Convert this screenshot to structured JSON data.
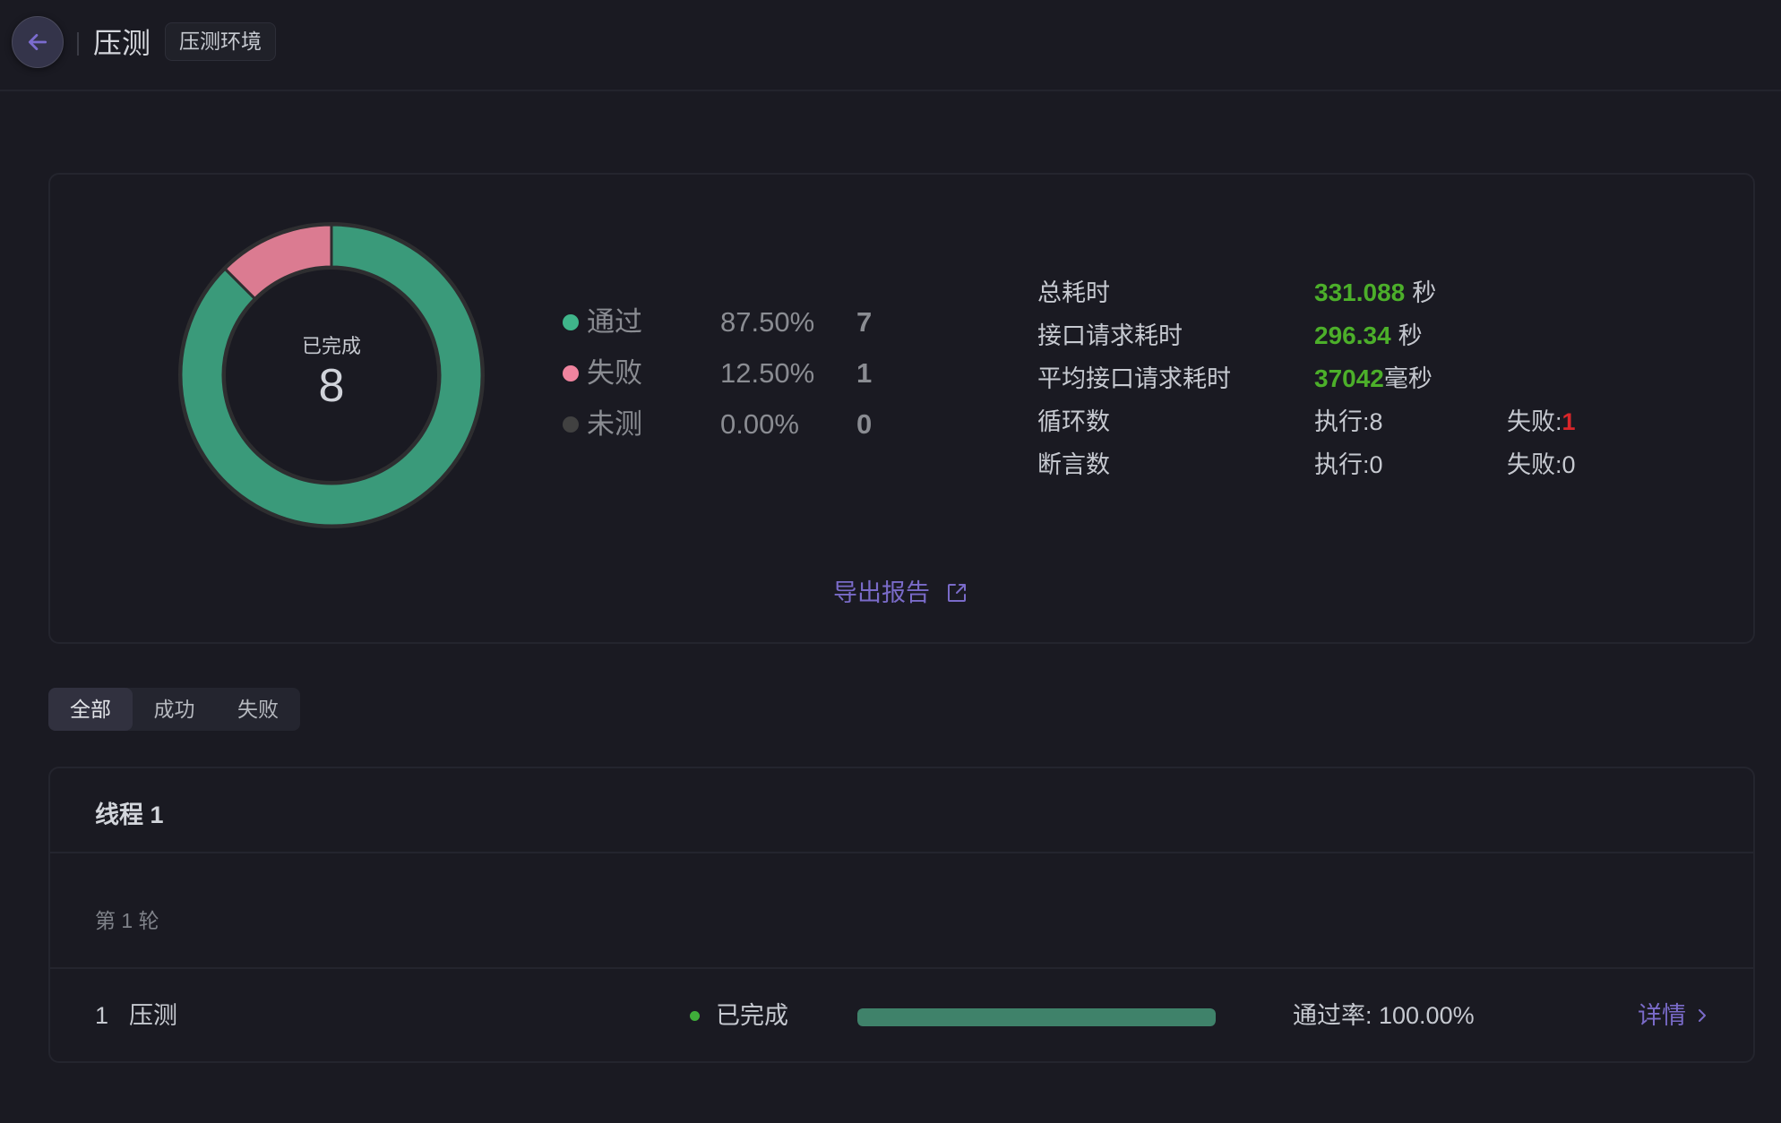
{
  "header": {
    "back_icon": "arrow-left-icon",
    "title": "压测",
    "env_badge": "压测环境"
  },
  "summary": {
    "chart_data": {
      "type": "pie",
      "variant": "donut",
      "title": "",
      "center_label": "已完成",
      "center_value": "8",
      "categories": [
        "通过",
        "失败",
        "未测"
      ],
      "values": [
        7,
        1,
        0
      ],
      "colors": [
        "#3a9a7a",
        "#db7b91",
        "#414141"
      ]
    },
    "legend": [
      {
        "name": "通过",
        "percent": "87.50%",
        "count": "7",
        "color": "#3fb58a"
      },
      {
        "name": "失败",
        "percent": "12.50%",
        "count": "1",
        "color": "#f0849f"
      },
      {
        "name": "未测",
        "percent": "0.00%",
        "count": "0",
        "color": "#414141"
      }
    ],
    "stats": {
      "total_time": {
        "label": "总耗时",
        "value": "331.088",
        "unit": "秒"
      },
      "request_time": {
        "label": "接口请求耗时",
        "value": "296.34",
        "unit": "秒"
      },
      "avg_request_time": {
        "label": "平均接口请求耗时",
        "value": "37042",
        "unit": "毫秒"
      },
      "loops": {
        "label": "循环数",
        "exec_label": "执行:",
        "exec_value": "8",
        "fail_label": "失败:",
        "fail_value": "1"
      },
      "assertions": {
        "label": "断言数",
        "exec_label": "执行:",
        "exec_value": "0",
        "fail_label": "失败:",
        "fail_value": "0"
      }
    },
    "export_label": "导出报告",
    "export_icon": "external-link-icon"
  },
  "tabs": [
    {
      "label": "全部",
      "active": true
    },
    {
      "label": "成功",
      "active": false
    },
    {
      "label": "失败",
      "active": false
    }
  ],
  "thread": {
    "title": "线程 1",
    "round_label": "第 1 轮",
    "rows": [
      {
        "index": "1",
        "name": "压测",
        "status": "已完成",
        "status_color": "#3fae3a",
        "progress": 1.0,
        "pass_rate": "通过率: 100.00%",
        "detail_label": "详情",
        "detail_icon": "chevron-right-icon"
      }
    ]
  },
  "colors": {
    "accent": "#7a6bc9",
    "success_text": "#4caf2a",
    "danger_text": "#d9262a",
    "progress_fill": "#3f826a",
    "background": "#1a1a22"
  }
}
